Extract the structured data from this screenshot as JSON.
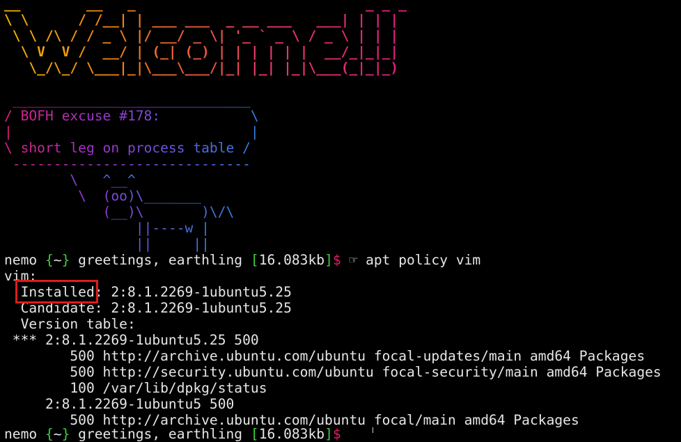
{
  "colors": {
    "background": "#000000",
    "text": "#e6e6e6",
    "prompt_bracket": "#3cd03c",
    "prompt_dollar": "#e0245e",
    "highlight_box": "#e01b1b",
    "banner_gradient": [
      "#f2b400",
      "#f07a1e",
      "#e8386a",
      "#e0207e"
    ],
    "cow_gradient": [
      "#e0207e",
      "#a531c9",
      "#6a55e0",
      "#3a7fe6"
    ]
  },
  "banner": {
    "lines": [
      "__        __   _                            _ _ _ ",
      "\\ \\      / /__| | ___ ___  _ __ ___   ___| | | |",
      " \\ \\ /\\ / / _ \\ |/ __/ _ \\| '_ ` _ \\ / _ \\ | | |",
      "  \\ V  V /  __/ | (_| (_) | | | | | |  __/_|_|_|",
      "   \\_/\\_/ \\___|_|\\___\\___/|_| |_| |_|\\___(_|_|_)"
    ]
  },
  "cowsay": {
    "lines": [
      " _____________________________",
      "/ BOFH excuse #178:           \\",
      "|                             |",
      "\\ short leg on process table /",
      " -----------------------------",
      "        \\   ^__^",
      "         \\  (oo)\\_______",
      "            (__)\\       )\\/\\",
      "                ||----w |",
      "                ||     ||"
    ]
  },
  "prompt": {
    "user": "nemo",
    "dir_open": "{",
    "dir": "~",
    "dir_close": "}",
    "greeting": "greetings, earthling",
    "size_open": "[",
    "size": "16.083kb",
    "size_close": "]",
    "dollar": "$",
    "hand_icon": "☞",
    "command": "apt policy vim"
  },
  "output": {
    "lines": [
      "vim:",
      "  Installed: 2:8.1.2269-1ubuntu5.25",
      "  Candidate: 2:8.1.2269-1ubuntu5.25",
      "  Version table:",
      " *** 2:8.1.2269-1ubuntu5.25 500",
      "        500 http://archive.ubuntu.com/ubuntu focal-updates/main amd64 Packages",
      "        500 http://security.ubuntu.com/ubuntu focal-security/main amd64 Packages",
      "        100 /var/lib/dpkg/status",
      "     2:8.1.2269-1ubuntu5 500",
      "        500 http://archive.ubuntu.com/ubuntu focal/main amd64 Packages"
    ]
  },
  "prompt2": {
    "user": "nemo",
    "dir_open": "{",
    "dir": "~",
    "dir_close": "}",
    "greeting": "greetings, earthling",
    "size_open": "[",
    "size": "16.083kb",
    "size_close": "]",
    "dollar": "$"
  }
}
